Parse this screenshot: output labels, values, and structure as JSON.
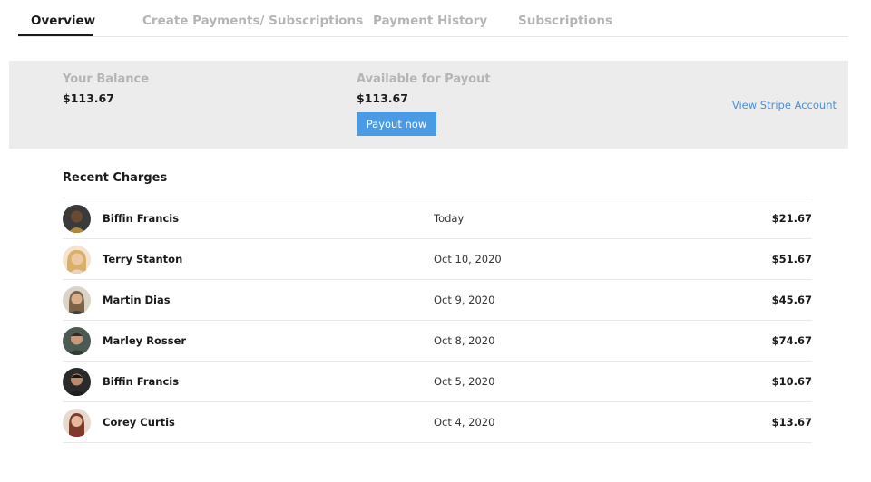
{
  "tabs": [
    {
      "label": "Overview",
      "active": true
    },
    {
      "label": "Create Payments/ Subscriptions",
      "active": false
    },
    {
      "label": "Payment History",
      "active": false
    },
    {
      "label": "Subscriptions",
      "active": false
    }
  ],
  "balance": {
    "your_balance_label": "Your Balance",
    "your_balance_value": "$113.67",
    "available_label": "Available for Payout",
    "available_value": "$113.67",
    "payout_button": "Payout now",
    "stripe_link": "View Stripe Account"
  },
  "recent_charges": {
    "title": "Recent Charges",
    "rows": [
      {
        "name": "Biffin Francis",
        "date": "Today",
        "amount": "$21.67",
        "avatar": "avatar-photo"
      },
      {
        "name": "Terry Stanton",
        "date": "Oct 10, 2020",
        "amount": "$51.67",
        "avatar": "avatar-photo"
      },
      {
        "name": "Martin Dias",
        "date": "Oct 9, 2020",
        "amount": "$45.67",
        "avatar": "avatar-photo"
      },
      {
        "name": "Marley Rosser",
        "date": "Oct 8, 2020",
        "amount": "$74.67",
        "avatar": "avatar-photo"
      },
      {
        "name": "Biffin Francis",
        "date": "Oct 5, 2020",
        "amount": "$10.67",
        "avatar": "avatar-photo"
      },
      {
        "name": "Corey Curtis",
        "date": "Oct 4, 2020",
        "amount": "$13.67",
        "avatar": "avatar-photo"
      }
    ]
  },
  "colors": {
    "accent": "#4a9be6",
    "link": "#4a90d9",
    "panel_bg": "#ececec",
    "muted_text": "#b5b5b5"
  }
}
